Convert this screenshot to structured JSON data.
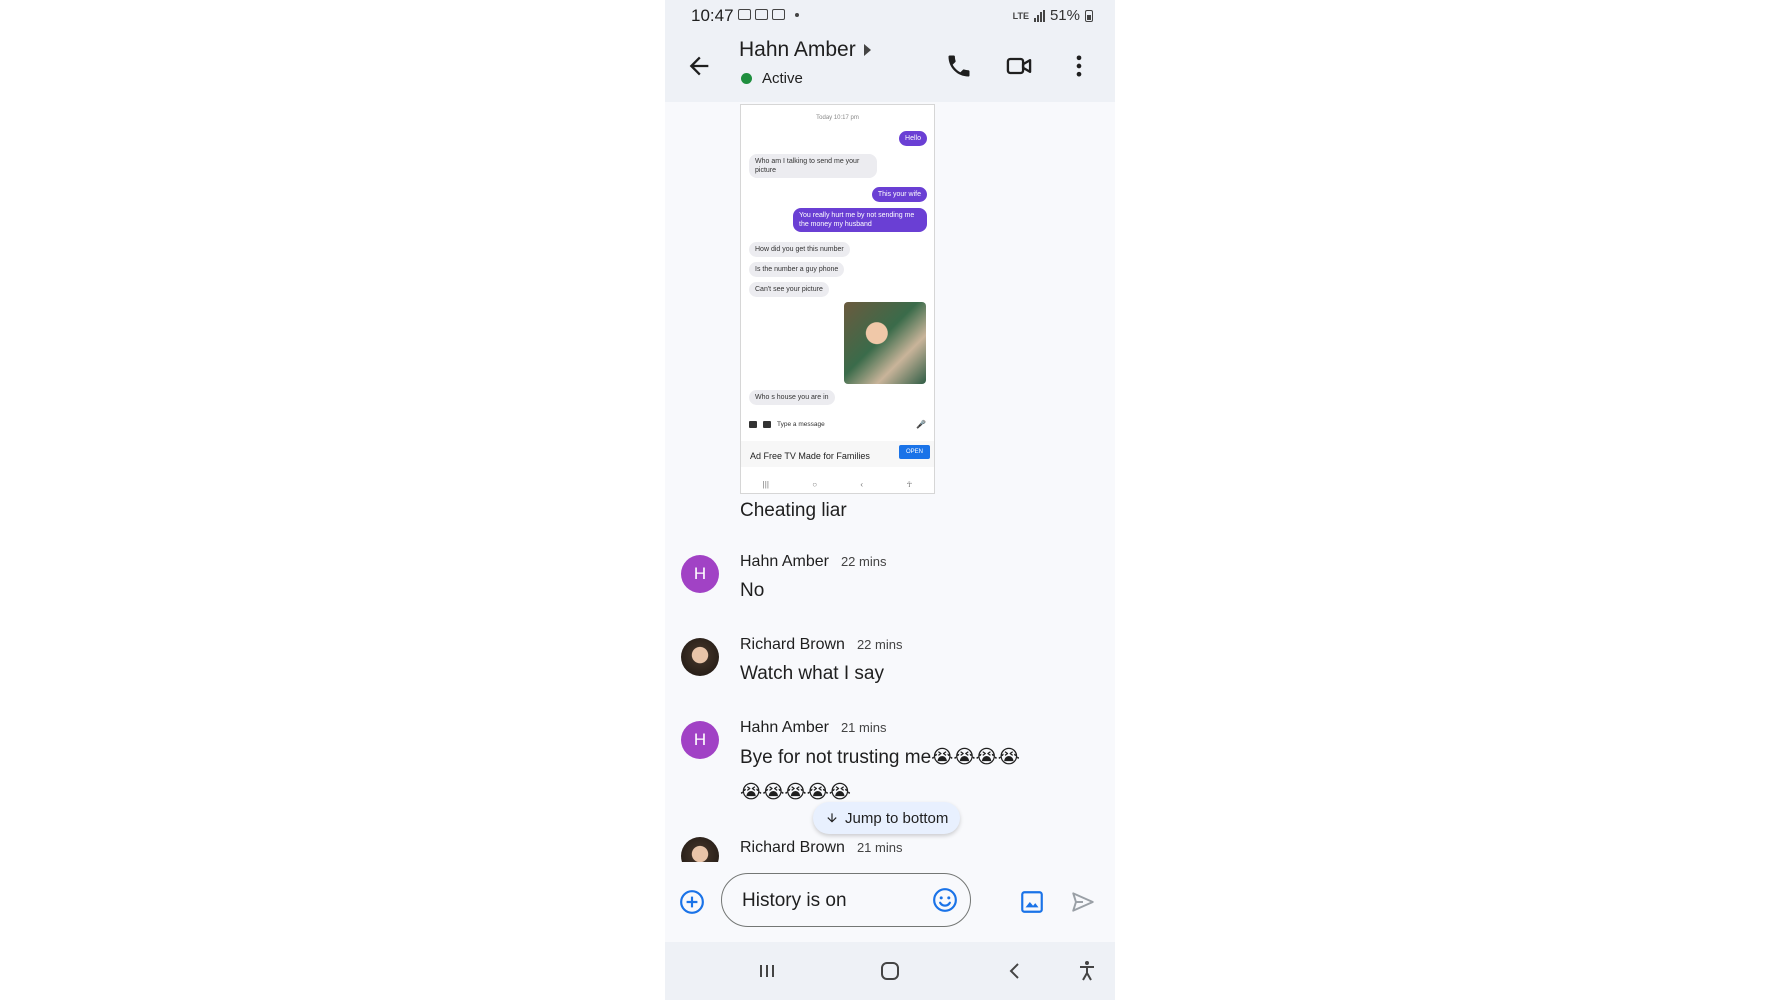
{
  "status_bar": {
    "time": "10:47",
    "network": "LTE",
    "battery": "51%"
  },
  "header": {
    "contact_name": "Hahn Amber",
    "status": "Active"
  },
  "shared_screenshot": {
    "timestamp": "Today 10:17 pm",
    "bubbles": [
      {
        "text": "Hello",
        "side": "out"
      },
      {
        "text": "Who am I talking to send me your picture",
        "side": "in"
      },
      {
        "text": "This your wife",
        "side": "out"
      },
      {
        "text": "You really hurt me by not sending me the money my husband",
        "side": "out"
      },
      {
        "text": "How did you get this number",
        "side": "in"
      },
      {
        "text": "Is the number a guy phone",
        "side": "in"
      },
      {
        "text": "Can't see your picture",
        "side": "in"
      },
      {
        "text": "Who s house you are in",
        "side": "in"
      }
    ],
    "compose_placeholder": "Type a message",
    "ad_text": "Ad Free TV Made for Families",
    "ad_button": "OPEN"
  },
  "caption": "Cheating liar",
  "messages": [
    {
      "avatar_letter": "H",
      "sender": "Hahn Amber",
      "time": "22 mins",
      "text": "No"
    },
    {
      "sender": "Richard Brown",
      "time": "22 mins",
      "text": "Watch what I say"
    },
    {
      "avatar_letter": "H",
      "sender": "Hahn Amber",
      "time": "21 mins",
      "text": "Bye for not trusting me😭😭😭😭",
      "emoji_line": "😭😭😭😭😭"
    },
    {
      "sender": "Richard Brown",
      "time": "21 mins"
    }
  ],
  "jump_to_bottom": "Jump to bottom",
  "compose": {
    "value": "History is on"
  },
  "colors": {
    "accent": "#1a73e8",
    "avatar_h": "#a142c5",
    "active_green": "#1e8e3e",
    "bubble_out": "#6a3fd4"
  }
}
